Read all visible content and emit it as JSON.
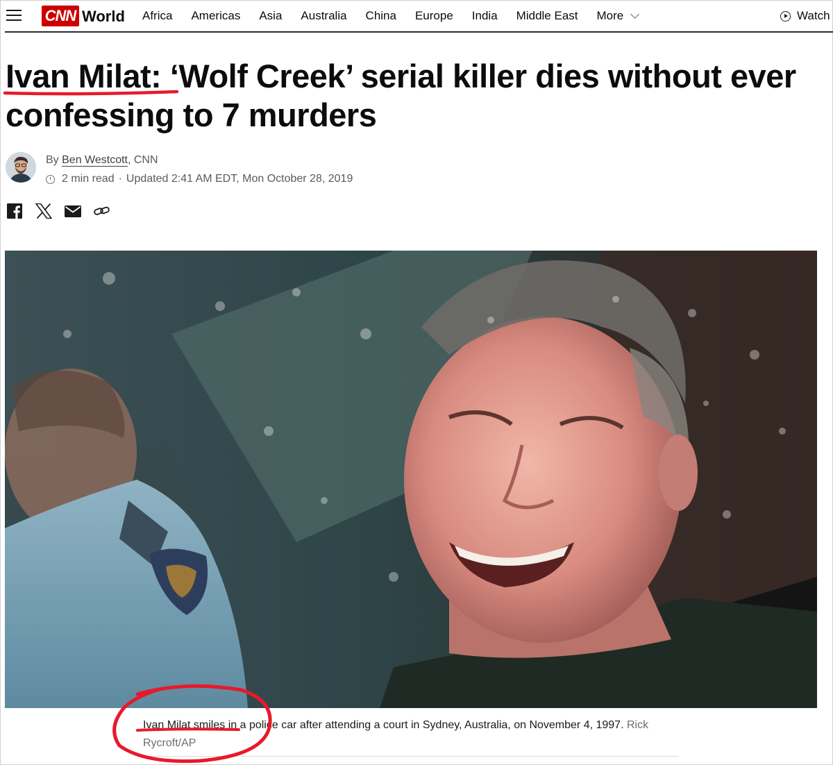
{
  "nav": {
    "logo": "CNN",
    "section": "World",
    "items": [
      {
        "label": "Africa"
      },
      {
        "label": "Americas"
      },
      {
        "label": "Asia"
      },
      {
        "label": "Australia"
      },
      {
        "label": "China"
      },
      {
        "label": "Europe"
      },
      {
        "label": "India"
      },
      {
        "label": "Middle East"
      }
    ],
    "more_label": "More",
    "watch_label": "Watch"
  },
  "article": {
    "headline": "Ivan Milat: ‘Wolf Creek’ serial killer dies without ever confessing to 7 murders",
    "byline_prefix": "By",
    "author": "Ben Westcott",
    "byline_suffix": ", CNN",
    "read_time": "2 min read",
    "separator": "·",
    "updated": "Updated 2:41 AM EDT, Mon October 28, 2019",
    "caption_highlighted": "Ivan Milat smiles in",
    "caption_rest": " a police car after attending a court in Sydney, Australia, on November 4, 1997.",
    "credit": " Rick Rycroft/AP"
  },
  "share": {
    "icons": [
      "facebook-icon",
      "x-icon",
      "email-icon",
      "link-icon"
    ]
  },
  "colors": {
    "brand_red": "#cc0000",
    "annotation_red": "#e8192c",
    "text": "#0c0c0c",
    "muted": "#5a5a5a"
  }
}
